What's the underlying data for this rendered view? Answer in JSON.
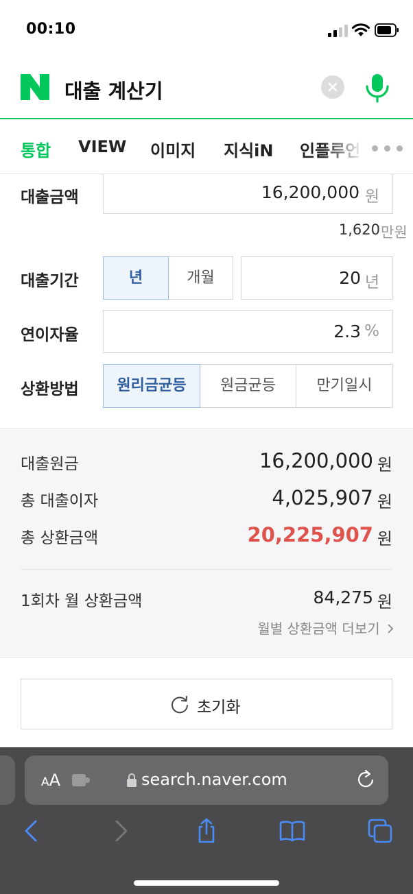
{
  "status_bar": {
    "time": "00:10"
  },
  "search": {
    "query": "대출 계산기"
  },
  "tabs": [
    {
      "label": "통합",
      "active": true
    },
    {
      "label": "VIEW",
      "active": false
    },
    {
      "label": "이미지",
      "active": false
    },
    {
      "label": "지식iN",
      "active": false
    },
    {
      "label": "인플루언",
      "active": false
    }
  ],
  "calculator": {
    "amount": {
      "label": "대출금액",
      "value": "16,200,000",
      "unit": "원",
      "helper_value": "1,620",
      "helper_unit": "만원"
    },
    "period": {
      "label": "대출기간",
      "options": [
        "년",
        "개월"
      ],
      "selected": "년",
      "value": "20",
      "unit": "년"
    },
    "rate": {
      "label": "연이자율",
      "value": "2.3",
      "unit": "%"
    },
    "method": {
      "label": "상환방법",
      "options": [
        "원리금균등",
        "원금균등",
        "만기일시"
      ],
      "selected": "원리금균등"
    }
  },
  "results": {
    "principal": {
      "label": "대출원금",
      "value": "16,200,000",
      "unit": "원"
    },
    "interest": {
      "label": "총 대출이자",
      "value": "4,025,907",
      "unit": "원"
    },
    "total": {
      "label": "총 상환금액",
      "value": "20,225,907",
      "unit": "원"
    },
    "first_payment": {
      "label": "1회차 월 상환금액",
      "value": "84,275",
      "unit": "원"
    },
    "monthly_link": "월별 상환금액 더보기"
  },
  "reset_label": "초기화",
  "browser": {
    "aa_small": "A",
    "aa_big": "A",
    "url": "search.naver.com"
  },
  "colors": {
    "naver_green": "#03c75a",
    "result_red": "#e0524c",
    "ios_blue": "#4a8cf7"
  }
}
